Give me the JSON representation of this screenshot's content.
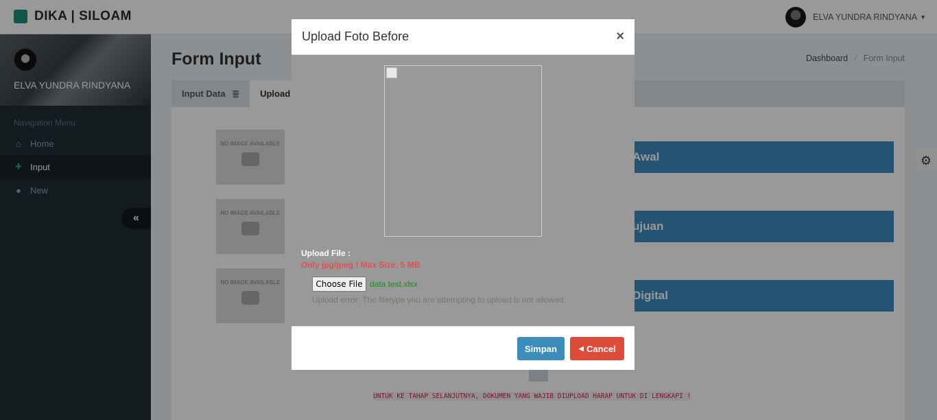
{
  "app": {
    "brand": "DIKA | SILOAM",
    "brand_color": "#1e8f7a"
  },
  "topbar": {
    "user_name": "ELVA YUNDRA RINDYANA"
  },
  "sidebar": {
    "user_name": "ELVA YUNDRA RINDYANA",
    "nav_header": "Navigation Menu",
    "items": [
      {
        "label": "Home",
        "icon": "home-icon"
      },
      {
        "label": "Input",
        "icon": "plus-icon",
        "active": true
      },
      {
        "label": "New",
        "icon": "user-icon"
      }
    ]
  },
  "page": {
    "title": "Form Input",
    "breadcrumb": [
      "Dashboard",
      "Form Input"
    ]
  },
  "panel": {
    "tabs": [
      {
        "label": "Input Data",
        "icon": "database-icon"
      },
      {
        "label": "Upload",
        "active": true
      }
    ],
    "thumb_text": "NO IMAGE AVAILABLE",
    "buttons": [
      "Awal",
      "ujuan",
      "Digital"
    ],
    "warning": "UNTUK KE TAHAP SELANJUTNYA, DOKUMEN YANG WAJIB DIUPLOAD HARAP UNTUK DI LENGKAPI !"
  },
  "modal": {
    "title": "Upload Foto Before",
    "close": "×",
    "upload_label": "Upload File :",
    "upload_hint": "Only jpg/jpeg ! Max Size: 5 MB",
    "choose_file": "Choose File",
    "file_name": "data test.xlsx",
    "upload_error": "Upload error: The filetype you are attempting to upload is not allowed.",
    "save_label": "Simpan",
    "cancel_label": "Cancel"
  },
  "colors": {
    "primary": "#3c8dbc",
    "danger": "#dd4b39",
    "sidebar": "#222d32"
  }
}
